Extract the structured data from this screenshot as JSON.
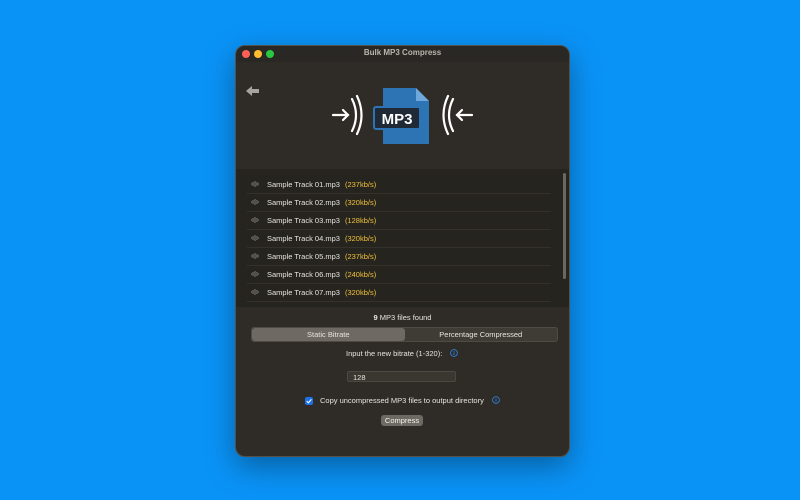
{
  "window": {
    "title": "Bulk MP3 Compress"
  },
  "hero": {
    "file_label": "MP3"
  },
  "files": [
    {
      "name": "Sample Track 01.mp3",
      "rate": "(237kb/s)"
    },
    {
      "name": "Sample Track 02.mp3",
      "rate": "(320kb/s)"
    },
    {
      "name": "Sample Track 03.mp3",
      "rate": "(128kb/s)"
    },
    {
      "name": "Sample Track 04.mp3",
      "rate": "(320kb/s)"
    },
    {
      "name": "Sample Track 05.mp3",
      "rate": "(237kb/s)"
    },
    {
      "name": "Sample Track 06.mp3",
      "rate": "(240kb/s)"
    },
    {
      "name": "Sample Track 07.mp3",
      "rate": "(320kb/s)"
    }
  ],
  "summary": {
    "count": "9",
    "text": "MP3 files found"
  },
  "mode_tabs": {
    "static": "Static Bitrate",
    "percentage": "Percentage Compressed",
    "selected": "Static Bitrate"
  },
  "bitrate": {
    "label": "Input the new bitrate (1-320):",
    "value": "128"
  },
  "copy_option": {
    "label": "Copy uncompressed MP3 files to output directory",
    "checked": true
  },
  "actions": {
    "compress": "Compress"
  },
  "colors": {
    "background": "#0a93f7",
    "file_icon": "#2c74b3",
    "rate": "#f1c23a",
    "checkbox": "#1d72e8"
  }
}
